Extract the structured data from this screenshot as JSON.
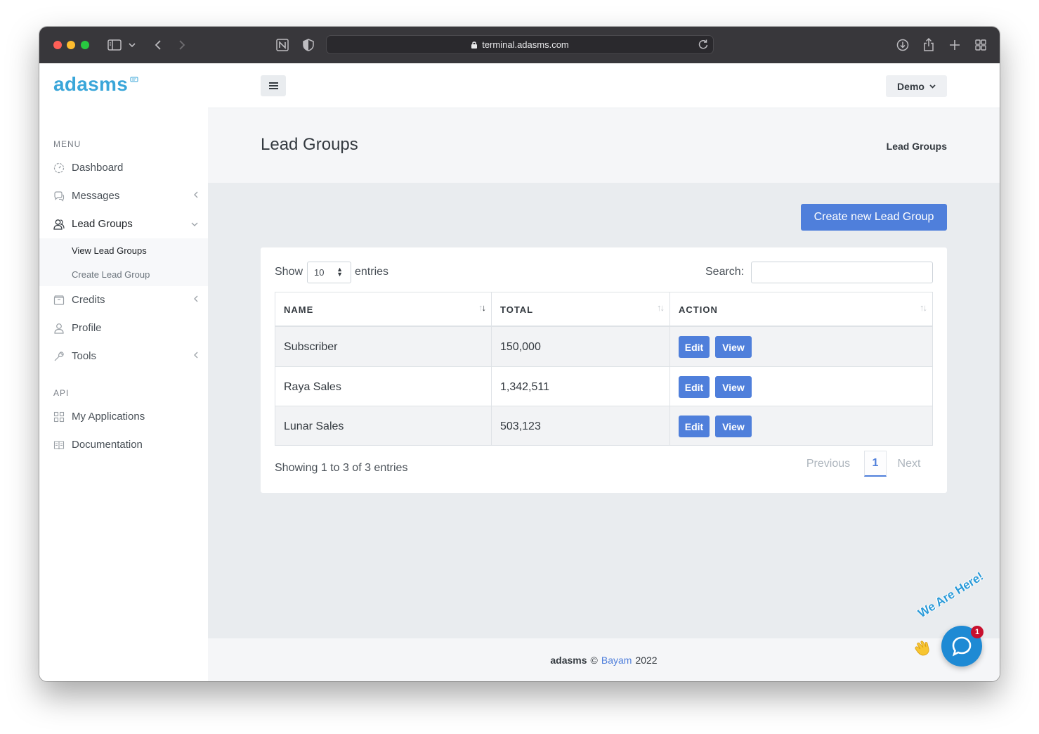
{
  "browser": {
    "url": "terminal.adasms.com"
  },
  "sidebar": {
    "logo": "adasms",
    "menu_title": "MENU",
    "items": [
      {
        "label": "Dashboard",
        "icon": "dashboard-icon"
      },
      {
        "label": "Messages",
        "icon": "messages-icon"
      },
      {
        "label": "Lead Groups",
        "icon": "users-icon"
      },
      {
        "label": "Credits",
        "icon": "wallet-icon"
      },
      {
        "label": "Profile",
        "icon": "user-icon"
      },
      {
        "label": "Tools",
        "icon": "wrench-icon"
      }
    ],
    "lead_group_submenu": [
      "View Lead Groups",
      "Create Lead Group"
    ],
    "api_title": "API",
    "api_items": [
      {
        "label": "My Applications",
        "icon": "grid-icon"
      },
      {
        "label": "Documentation",
        "icon": "book-icon"
      }
    ]
  },
  "topbar": {
    "user_label": "Demo"
  },
  "page": {
    "title": "Lead Groups",
    "breadcrumb": "Lead Groups",
    "create_button": "Create new Lead Group"
  },
  "table": {
    "show_label": "Show",
    "page_length": "10",
    "entries_label": "entries",
    "search_label": "Search:",
    "search_value": "",
    "columns": [
      "NAME",
      "TOTAL",
      "ACTION"
    ],
    "rows": [
      {
        "name": "Subscriber",
        "total": "150,000"
      },
      {
        "name": "Raya Sales",
        "total": "1,342,511"
      },
      {
        "name": "Lunar Sales",
        "total": "503,123"
      }
    ],
    "edit_label": "Edit",
    "view_label": "View",
    "info": "Showing 1 to 3 of 3 entries",
    "pagination": {
      "previous": "Previous",
      "current": "1",
      "next": "Next"
    }
  },
  "footer": {
    "brand": "adasms",
    "copyright": "©",
    "link": "Bayam",
    "year": "2022"
  },
  "chat": {
    "tagline": "We Are Here!",
    "badge_count": "1"
  },
  "colors": {
    "accent": "#4f7fdb",
    "logo": "#3aa6d9",
    "chat": "#1e8ad4"
  }
}
